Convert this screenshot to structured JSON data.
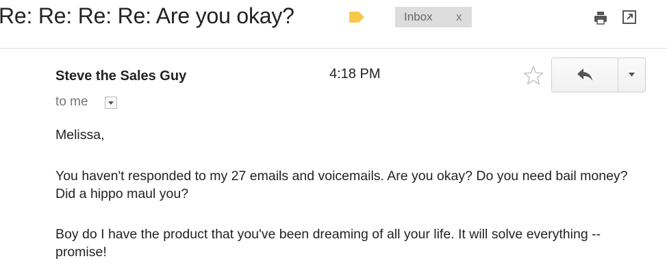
{
  "message": {
    "subject": "Re: Re: Re: Re: Are you okay?",
    "label_color": "#f6c84c",
    "label_chip": {
      "text": "Inbox",
      "remove": "x"
    },
    "sender": "Steve the Sales Guy",
    "time": "4:18 PM",
    "recipient": "to me",
    "body": {
      "greeting": "Melissa,",
      "paragraphs": [
        "You haven't responded to my 27 emails and voicemails. Are you okay? Do you need bail money? Did a hippo maul you?",
        "Boy do I have the product that you've been dreaming of all your life. It will solve everything -- promise!"
      ]
    }
  },
  "icons": {
    "label": "label-tag-icon",
    "print": "print-icon",
    "popout": "new-window-icon",
    "star": "star-outline-icon",
    "reply": "reply-arrow-icon",
    "more": "caret-down-icon",
    "recipient_details": "caret-down-icon"
  }
}
